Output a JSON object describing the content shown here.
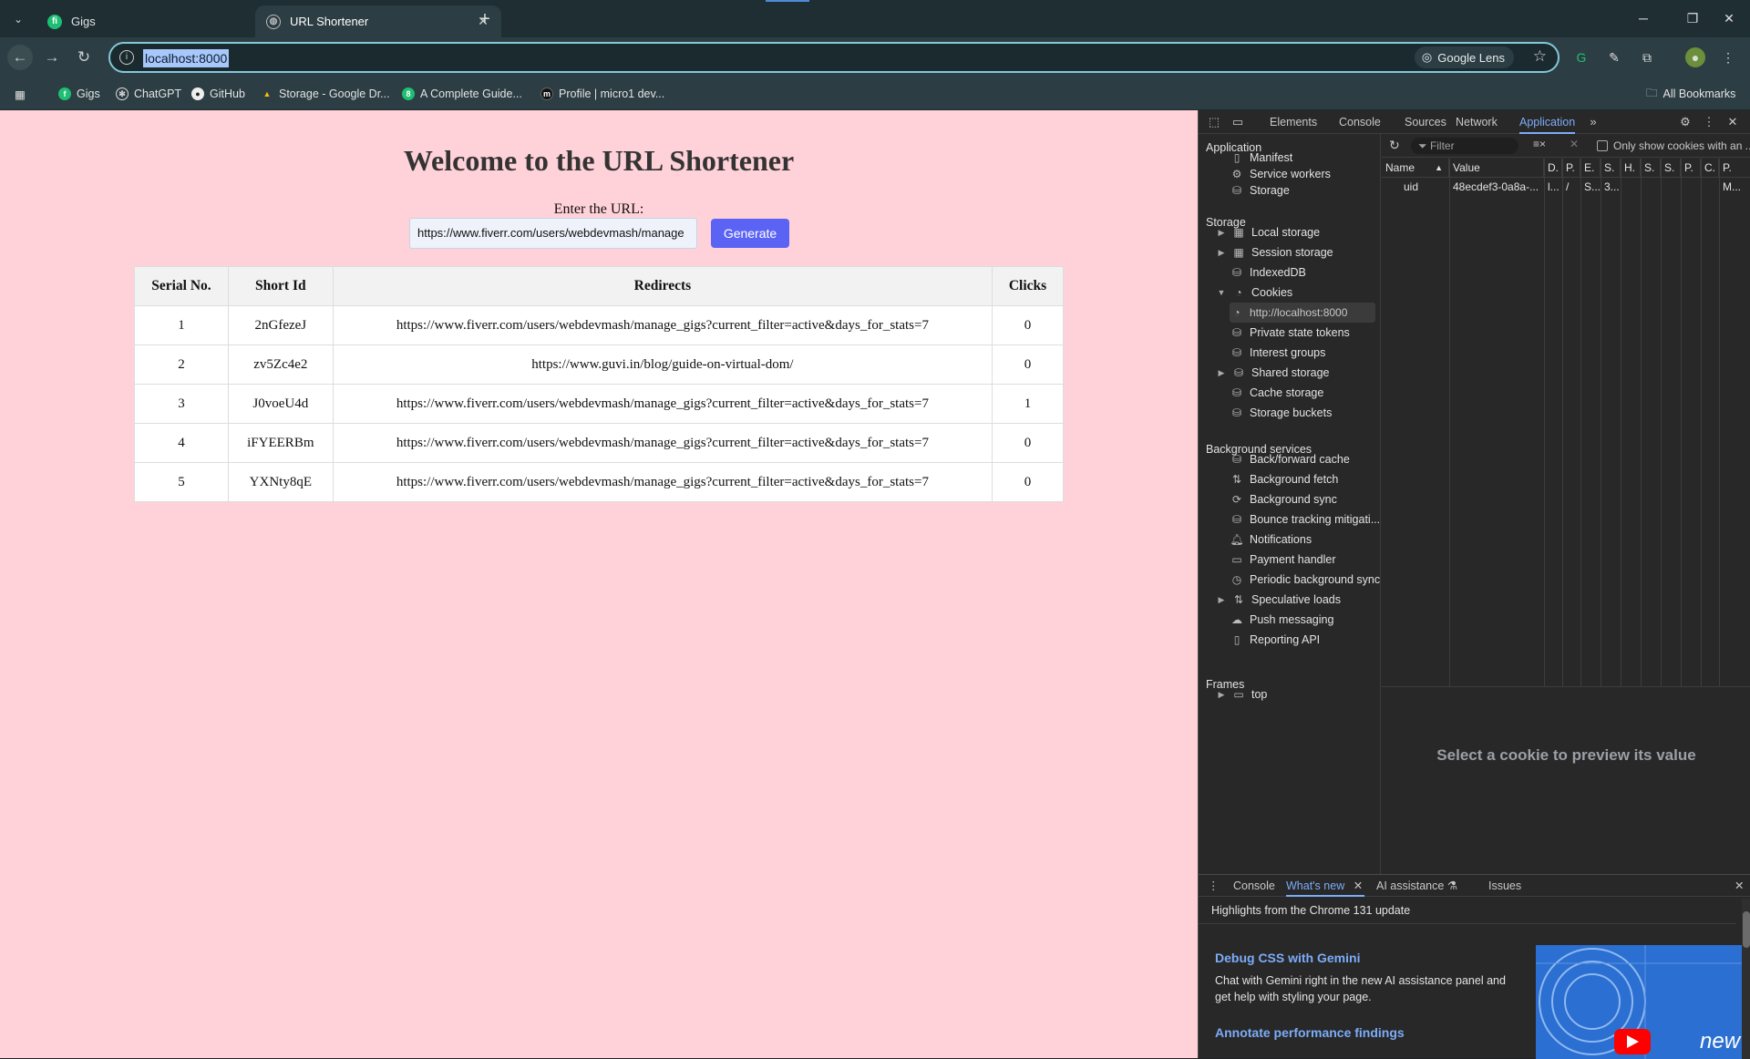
{
  "browser": {
    "tabs": [
      {
        "title": "Gigs",
        "favicon": "fiverr-icon",
        "favicon_text": "fi",
        "favicon_color": "#1dbf73"
      },
      {
        "title": "URL Shortener",
        "favicon": "globe-icon"
      }
    ],
    "address": "localhost:8000",
    "lens_label": "Google Lens",
    "bookmarks": [
      {
        "label": "Gigs"
      },
      {
        "label": "ChatGPT"
      },
      {
        "label": "GitHub"
      },
      {
        "label": "Storage - Google Dr..."
      },
      {
        "label": "A Complete Guide..."
      },
      {
        "label": "Profile | micro1 dev..."
      }
    ],
    "all_bookmarks": "All Bookmarks"
  },
  "page": {
    "heading": "Welcome to the URL Shortener",
    "input_label": "Enter the URL:",
    "input_value": "https://www.fiverr.com/users/webdevmash/manage",
    "generate_label": "Generate",
    "table": {
      "headers": [
        "Serial No.",
        "Short Id",
        "Redirects",
        "Clicks"
      ],
      "rows": [
        [
          "1",
          "2nGfezeJ",
          "https://www.fiverr.com/users/webdevmash/manage_gigs?current_filter=active&days_for_stats=7",
          "0"
        ],
        [
          "2",
          "zv5Zc4e2",
          "https://www.guvi.in/blog/guide-on-virtual-dom/",
          "0"
        ],
        [
          "3",
          "J0voeU4d",
          "https://www.fiverr.com/users/webdevmash/manage_gigs?current_filter=active&days_for_stats=7",
          "1"
        ],
        [
          "4",
          "iFYEERBm",
          "https://www.fiverr.com/users/webdevmash/manage_gigs?current_filter=active&days_for_stats=7",
          "0"
        ],
        [
          "5",
          "YXNty8qE",
          "https://www.fiverr.com/users/webdevmash/manage_gigs?current_filter=active&days_for_stats=7",
          "0"
        ]
      ]
    }
  },
  "devtools": {
    "tabs": [
      "Elements",
      "Console",
      "Sources",
      "Network",
      "Application"
    ],
    "selected_tab": "Application",
    "sections": {
      "application": "Application",
      "application_items": [
        "Manifest",
        "Service workers",
        "Storage"
      ],
      "storage": "Storage",
      "storage_items": [
        "Local storage",
        "Session storage",
        "IndexedDB",
        "Cookies",
        "http://localhost:8000",
        "Private state tokens",
        "Interest groups",
        "Shared storage",
        "Cache storage",
        "Storage buckets"
      ],
      "background": "Background services",
      "background_items": [
        "Back/forward cache",
        "Background fetch",
        "Background sync",
        "Bounce tracking mitigati...",
        "Notifications",
        "Payment handler",
        "Periodic background sync",
        "Speculative loads",
        "Push messaging",
        "Reporting API"
      ],
      "frames": "Frames",
      "frames_items": [
        "top"
      ]
    },
    "filter_placeholder": "Filter",
    "only_show_label": "Only show cookies with an ...",
    "cookie_columns": [
      "Name",
      "Value",
      "D.",
      "P.",
      "E.",
      "S.",
      "H.",
      "S.",
      "S.",
      "P.",
      "C.",
      "P."
    ],
    "cookie_row": [
      "uid",
      "48ecdef3-0a8a-...",
      "l...",
      "/",
      "S...",
      "3...",
      "",
      "",
      "",
      "",
      "",
      "M..."
    ],
    "preview_text": "Select a cookie to preview its value",
    "drawer_tabs": [
      "Console",
      "What's new",
      "AI assistance",
      "Issues"
    ],
    "drawer_selected": "What's new",
    "whats_new": {
      "header": "Highlights from the Chrome 131 update",
      "title1": "Debug CSS with Gemini",
      "body1": "Chat with Gemini right in the new AI assistance panel and get help with styling your page.",
      "title2": "Annotate performance findings",
      "thumb_text": "new"
    }
  }
}
